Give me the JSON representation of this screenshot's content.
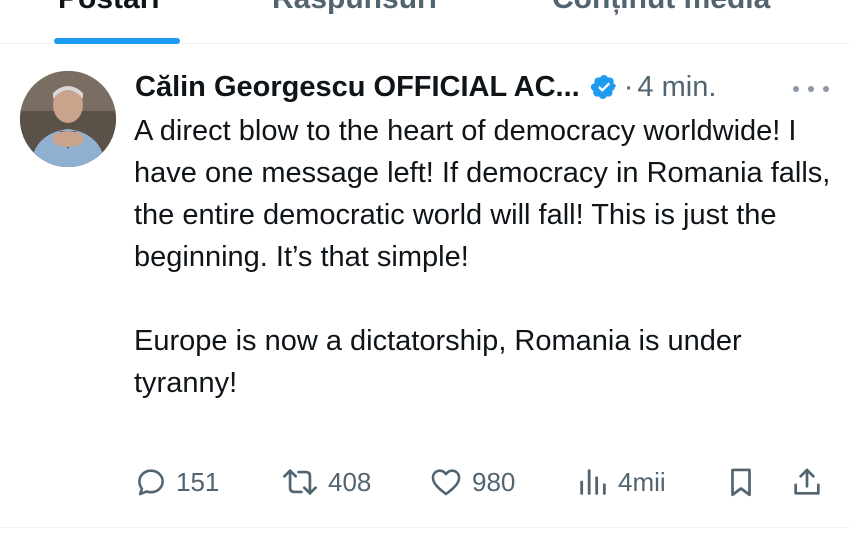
{
  "tabs": [
    {
      "label": "Postări",
      "active": true
    },
    {
      "label": "Răspunsuri",
      "active": false
    },
    {
      "label": "Conținut media",
      "active": false
    }
  ],
  "tweet": {
    "author_name": "Călin Georgescu OFFICIAL AC...",
    "separator": "·",
    "time": "4 min.",
    "paragraphs": [
      "A direct blow to the heart of democracy worldwide! I have one message left! If democracy in Romania falls, the entire democratic world will fall! This is just the beginning. It’s that simple!",
      "Europe is now a dictatorship, Romania is under tyranny!"
    ],
    "stats": {
      "replies": "151",
      "reposts": "408",
      "likes": "980",
      "views": "4mii"
    }
  },
  "colors": {
    "accent": "#1d9bf0",
    "text_primary": "#0f1419",
    "text_secondary": "#536471",
    "divider": "#eff3f4"
  },
  "icons": [
    "verified-badge-icon",
    "more-icon",
    "reply-icon",
    "repost-icon",
    "like-icon",
    "views-icon",
    "bookmark-icon",
    "share-icon"
  ]
}
